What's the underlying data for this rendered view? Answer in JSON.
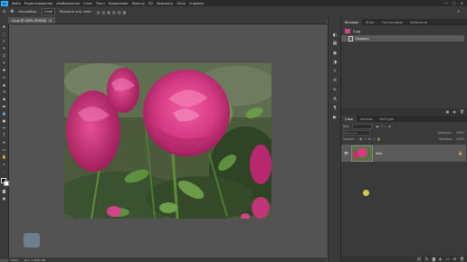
{
  "app": {
    "logo": "Ps"
  },
  "menu": [
    "Файл",
    "Редактирование",
    "Изображение",
    "Слои",
    "Текст",
    "Выделение",
    "Фильтр",
    "3D",
    "Просмотр",
    "Окно",
    "Справка"
  ],
  "window_controls": [
    "—",
    "▢",
    "✕"
  ],
  "options_bar": {
    "tool_icon": "move-tool-icon",
    "auto_select_label": "Автовыбор:",
    "auto_select_value": "Слой",
    "transform_label": "Показать упр. элем."
  },
  "document": {
    "tab_title": "Х.jpg @ 100% (RGB/8)",
    "zoom": "100%",
    "doc_size": "Док: 1,9M/1,9M"
  },
  "panels": {
    "history": {
      "tabs": [
        "История",
        "Инфо",
        "Гистограмма",
        "Навигатор"
      ],
      "snapshot_label": "Х.jpg",
      "step_label": "Открыть"
    },
    "layers": {
      "tabs": [
        "Слои",
        "Каналы",
        "Контуры"
      ],
      "filter_label": "Вид",
      "blend_mode": "Обычные",
      "opacity_label": "Непрозр.:",
      "opacity_value": "100%",
      "lock_label": "Закреп.:",
      "fill_label": "Заливка:",
      "fill_value": "100%",
      "layer_name": "Фон"
    }
  },
  "colors": {
    "accent": "#31a8ff",
    "panel": "#3a3a3a",
    "workspace": "#535353"
  }
}
